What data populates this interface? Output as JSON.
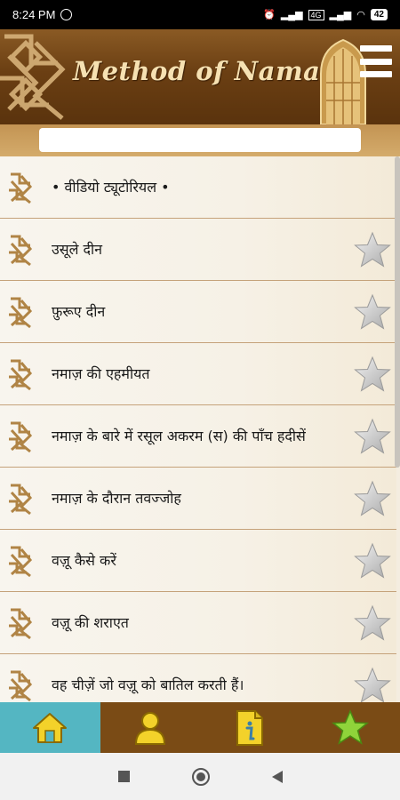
{
  "status_bar": {
    "time": "8:24 PM",
    "network": "4G",
    "battery": "42"
  },
  "header": {
    "title": "Method of Namaz"
  },
  "search": {
    "value": "",
    "placeholder": ""
  },
  "list": {
    "items": [
      {
        "label": "• वीडियो ट्यूटोरियल •",
        "favorite": null
      },
      {
        "label": "उसूले दीन",
        "favorite": false
      },
      {
        "label": "फ़ुरूए दीन",
        "favorite": false
      },
      {
        "label": "नमाज़ की एहमीयत",
        "favorite": false
      },
      {
        "label": "नमाज़ के बारे में रसूल अकरम (स) की पाँच हदीसें",
        "favorite": false
      },
      {
        "label": "नमाज़ के दौरान तवज्जोह",
        "favorite": false
      },
      {
        "label": "वज़ू कैसे करें",
        "favorite": false
      },
      {
        "label": "वज़ू की शराएत",
        "favorite": false
      },
      {
        "label": "वह चीज़ें जो वज़ू को बातिल करती हैं।",
        "favorite": false
      }
    ]
  },
  "tabs": [
    {
      "icon": "home-icon",
      "active": true
    },
    {
      "icon": "profile-icon",
      "active": false
    },
    {
      "icon": "info-icon",
      "active": false
    },
    {
      "icon": "favorites-star-icon",
      "active": false
    }
  ],
  "colors": {
    "header": "#6b3f13",
    "tab_active": "#54b6c2",
    "tab_bar": "#7a4b15",
    "icon_yellow": "#f3d22a",
    "star_green": "#8fd43a"
  }
}
